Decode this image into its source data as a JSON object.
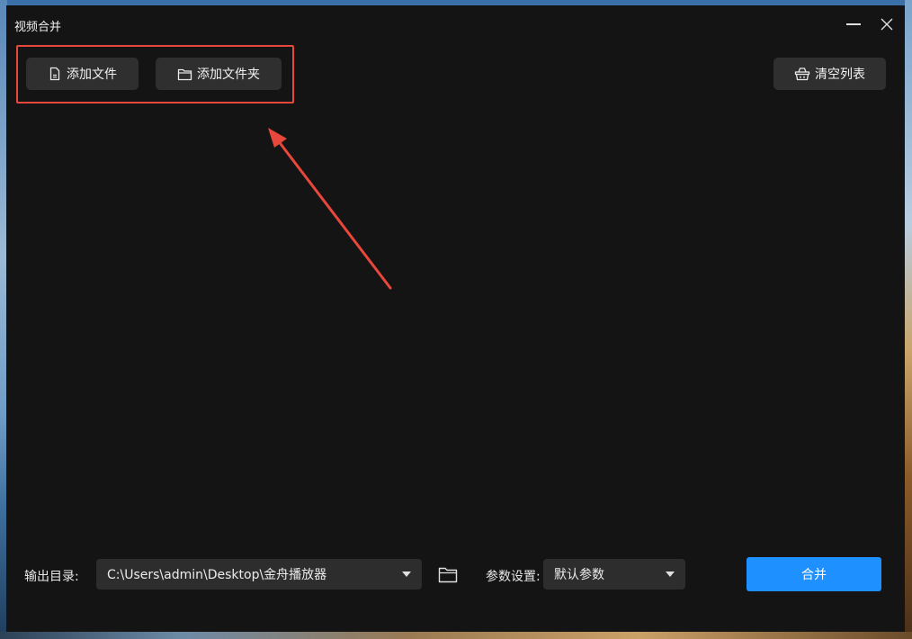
{
  "window": {
    "title": "视频合并"
  },
  "toolbar": {
    "add_file_label": "添加文件",
    "add_folder_label": "添加文件夹",
    "clear_list_label": "清空列表"
  },
  "output": {
    "label": "输出目录:",
    "path": "C:\\Users\\admin\\Desktop\\金舟播放器"
  },
  "params": {
    "label": "参数设置:",
    "selected": "默认参数"
  },
  "merge_button_label": "合并",
  "colors": {
    "window_bg": "#141414",
    "button_bg": "#2f2f2f",
    "accent": "#1e90ff",
    "annotation": "#e8473c"
  },
  "icons": {
    "add_file": "file-icon",
    "add_folder": "folder-icon",
    "clear_list": "basket-icon",
    "browse": "folder-icon"
  }
}
